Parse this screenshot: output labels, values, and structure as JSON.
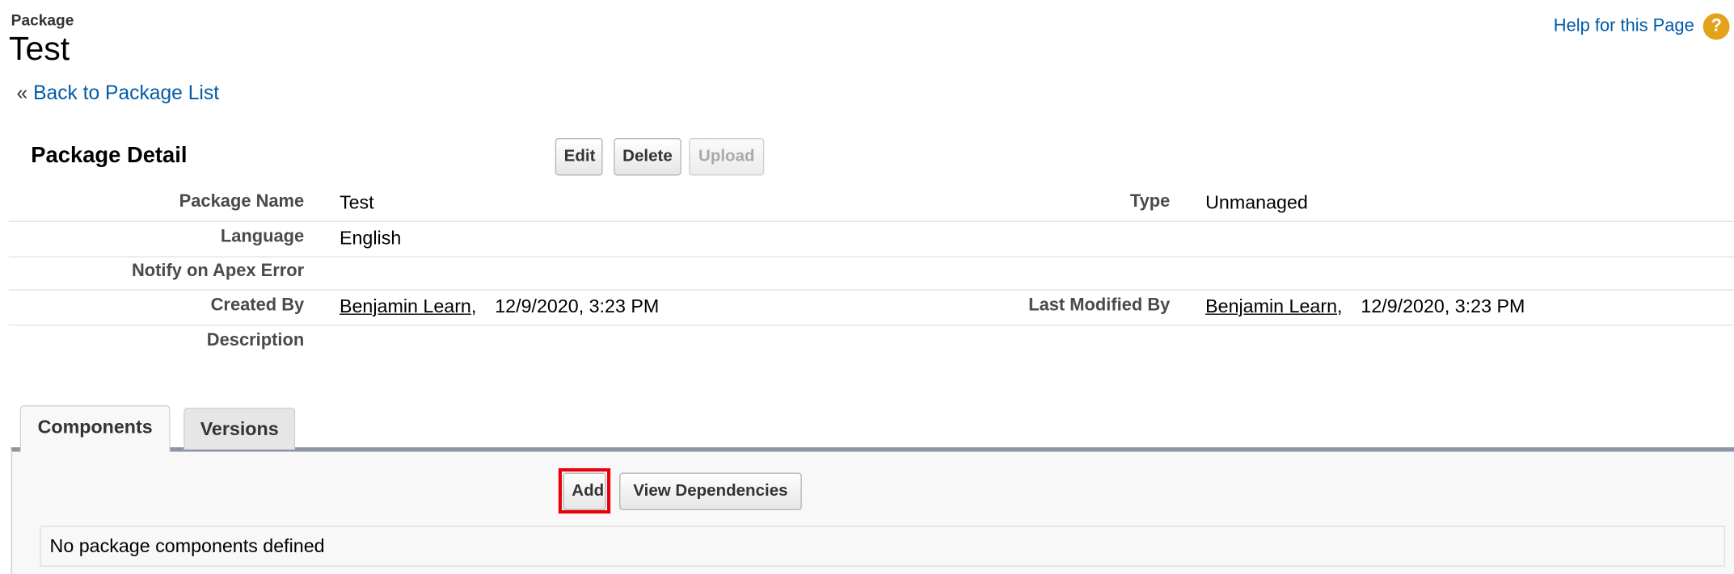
{
  "header": {
    "object_type": "Package",
    "title": "Test",
    "help_label": "Help for this Page",
    "help_icon": "question-circle-icon",
    "back_prefix": "«",
    "back_label": "Back to Package List"
  },
  "detail": {
    "section_title": "Package Detail",
    "buttons": {
      "edit": "Edit",
      "delete": "Delete",
      "upload": "Upload"
    },
    "fields": {
      "package_name": {
        "label": "Package Name",
        "value": "Test"
      },
      "type": {
        "label": "Type",
        "value": "Unmanaged"
      },
      "language": {
        "label": "Language",
        "value": "English"
      },
      "notify_apex_error": {
        "label": "Notify on Apex Error",
        "value": ""
      },
      "created_by": {
        "label": "Created By",
        "user": "Benjamin Learn",
        "date": "12/9/2020, 3:23 PM"
      },
      "last_modified_by": {
        "label": "Last Modified By",
        "user": "Benjamin Learn",
        "date": "12/9/2020, 3:23 PM"
      },
      "description": {
        "label": "Description",
        "value": ""
      }
    }
  },
  "tabs": [
    {
      "label": "Components",
      "active": true
    },
    {
      "label": "Versions",
      "active": false
    }
  ],
  "components": {
    "add_label": "Add",
    "view_dependencies_label": "View Dependencies",
    "empty_message": "No package components defined"
  },
  "colors": {
    "link": "#015ba7",
    "highlight": "#e8000b",
    "tab_border": "#8e95a6",
    "help_icon": "#e3a21a"
  }
}
